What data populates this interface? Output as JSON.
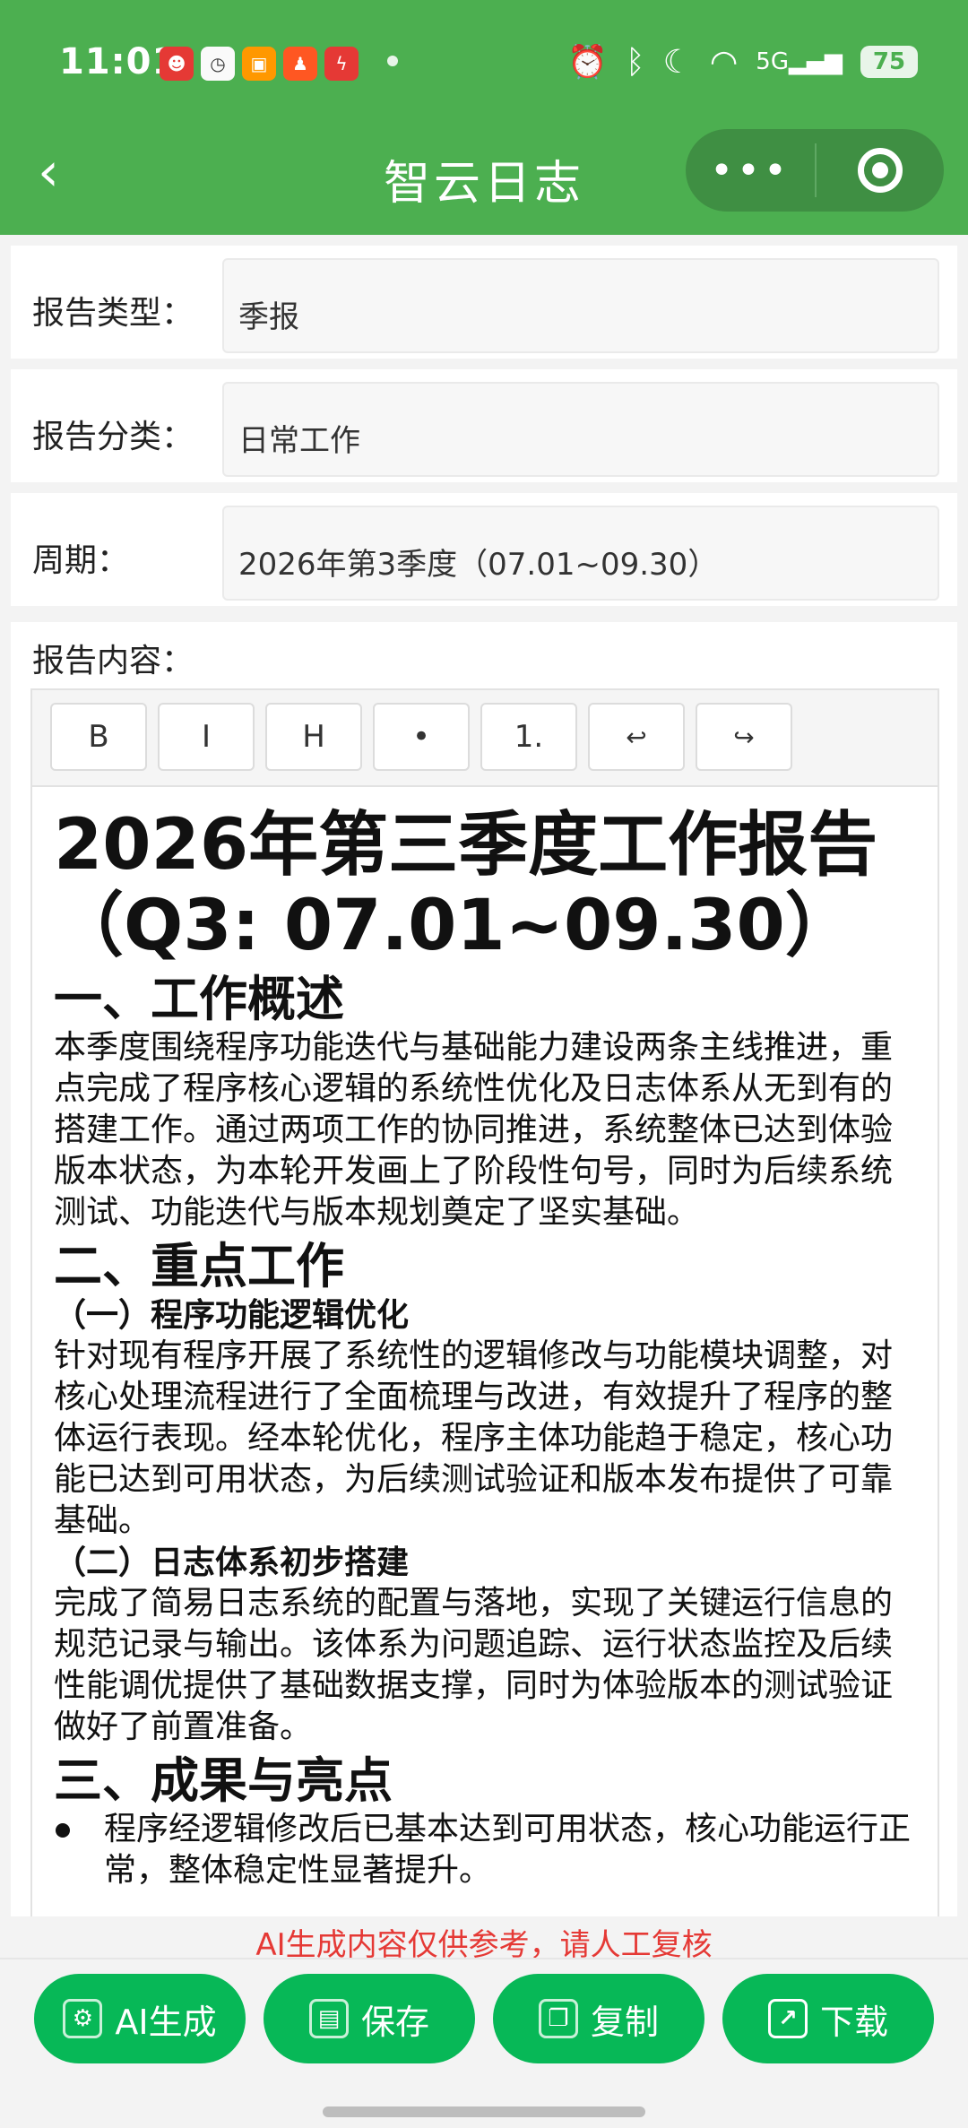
{
  "status_bar": {
    "time": "11:01",
    "battery": "75",
    "signal": "5G"
  },
  "nav": {
    "back_glyph": "‹",
    "title": "智云日志",
    "more_glyph": "•••"
  },
  "form": {
    "type_label": "报告类型：",
    "type_value": "季报",
    "category_label": "报告分类：",
    "category_value": "日常工作",
    "period_label": "周期：",
    "period_value": "2026年第3季度（07.01~09.30）"
  },
  "content": {
    "label": "报告内容：",
    "toolbar": {
      "bold": "B",
      "italic": "I",
      "heading": "H",
      "bullet": "•",
      "ordered": "1.",
      "undo": "↩",
      "redo": "↪"
    },
    "title": "2026年第三季度工作报告（Q3: 07.01~09.30）",
    "s1_heading": "一、工作概述",
    "s1_para": "本季度围绕程序功能迭代与基础能力建设两条主线推进，重点完成了程序核心逻辑的系统性优化及日志体系从无到有的搭建工作。通过两项工作的协同推进，系统整体已达到体验版本状态，为本轮开发画上了阶段性句号，同时为后续系统测试、功能迭代与版本规划奠定了坚实基础。",
    "s2_heading": "二、重点工作",
    "s2_sub1": "（一）程序功能逻辑优化",
    "s2_para1": "针对现有程序开展了系统性的逻辑修改与功能模块调整，对核心处理流程进行了全面梳理与改进，有效提升了程序的整体运行表现。经本轮优化，程序主体功能趋于稳定，核心功能已达到可用状态，为后续测试验证和版本发布提供了可靠基础。",
    "s2_sub2": "（二）日志体系初步搭建",
    "s2_para2": "完成了简易日志系统的配置与落地，实现了关键运行信息的规范记录与输出。该体系为问题追踪、运行状态监控及后续性能调优提供了基础数据支撑，同时为体验版本的测试验证做好了前置准备。",
    "s3_heading": "三、成果与亮点",
    "s3_bullet1": "程序经逻辑修改后已基本达到可用状态，核心功能运行正常，整体稳定性显著提升。"
  },
  "disclaimer": "AI生成内容仅供参考，请人工复核",
  "actions": {
    "generate": "AI生成",
    "save": "保存",
    "copy": "复制",
    "download": "下载"
  },
  "colors": {
    "primary": "#4CAF50",
    "button": "#07b857",
    "warning": "#e53935"
  }
}
